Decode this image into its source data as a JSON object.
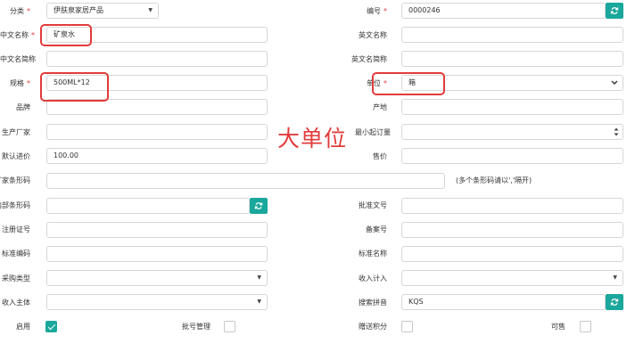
{
  "fields": {
    "category": {
      "label": "分类",
      "value": "伊肤泉家居产品"
    },
    "code": {
      "label": "编号",
      "value": "0000246"
    },
    "cn_name": {
      "label": "中文名称",
      "value": "矿泉水"
    },
    "en_name": {
      "label": "英文名称",
      "value": ""
    },
    "cn_short": {
      "label": "中文名简称",
      "value": ""
    },
    "en_short": {
      "label": "英文名简称",
      "value": ""
    },
    "spec": {
      "label": "规格",
      "value": "500ML*12"
    },
    "unit": {
      "label": "单位",
      "value": "箱"
    },
    "brand": {
      "label": "品牌",
      "value": ""
    },
    "origin": {
      "label": "产地",
      "value": ""
    },
    "manufacturer": {
      "label": "生产厂家",
      "value": ""
    },
    "min_order": {
      "label": "最小起订量",
      "value": ""
    },
    "default_price": {
      "label": "默认进价",
      "value": "100.00"
    },
    "sale_price": {
      "label": "售价",
      "value": ""
    },
    "factory_barcode": {
      "label": "厂家条形码",
      "value": ""
    },
    "barcode_hint": "(多个条形码请以','隔开)",
    "internal_barcode": {
      "label": "内部条形码",
      "value": ""
    },
    "approval_no": {
      "label": "批准文号",
      "value": ""
    },
    "reg_cert": {
      "label": "注册证号",
      "value": ""
    },
    "record_no": {
      "label": "备案号",
      "value": ""
    },
    "std_code": {
      "label": "标准编码",
      "value": ""
    },
    "std_name": {
      "label": "标准名称",
      "value": ""
    },
    "purchase_type": {
      "label": "采购类型",
      "value": ""
    },
    "income_account": {
      "label": "收入计入",
      "value": ""
    },
    "income_entity": {
      "label": "收入主体",
      "value": ""
    },
    "search_pinyin": {
      "label": "搜索拼音",
      "value": "KQS"
    }
  },
  "checks": {
    "enabled": {
      "label": "启用",
      "checked": true
    },
    "batch": {
      "label": "批号管理",
      "checked": false
    },
    "gift_points": {
      "label": "赠送积分",
      "checked": false
    },
    "saleable": {
      "label": "可售",
      "checked": false
    }
  },
  "annotation": "大单位",
  "colors": {
    "accent": "#1aa79c",
    "highlight": "#e23b3b"
  },
  "icons": {
    "refresh": "refresh-icon",
    "chevron": "chevron-down-icon"
  }
}
